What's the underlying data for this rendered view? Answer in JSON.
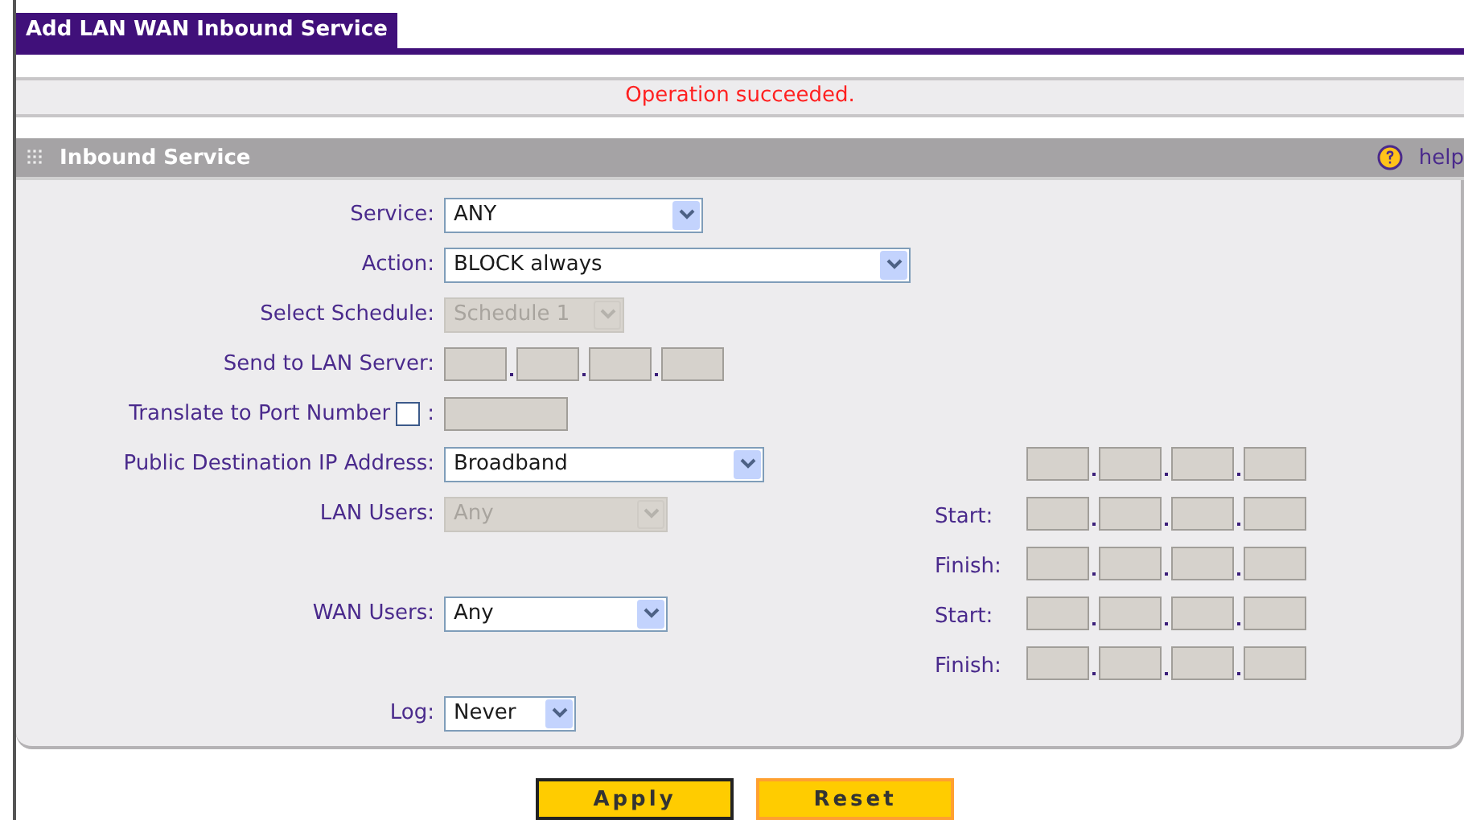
{
  "tab": {
    "title": "Add LAN WAN Inbound Service"
  },
  "message": "Operation succeeded.",
  "section": {
    "title": "Inbound Service",
    "help": "help"
  },
  "rows": [
    {
      "field": {
        "kind": "select",
        "label": "Service:",
        "value": "ANY",
        "disabled": false
      }
    },
    {
      "field": {
        "kind": "select",
        "label": "Action:",
        "value": "BLOCK always",
        "disabled": false
      }
    },
    {
      "field": {
        "kind": "select",
        "label": "Select Schedule:",
        "value": "Schedule 1",
        "disabled": true
      }
    },
    {
      "field": {
        "kind": "ip",
        "label": "Send to LAN Server:"
      }
    },
    {
      "field": {
        "kind": "port",
        "label": "Translate to Port Number",
        "separator": ":",
        "checked": false
      }
    },
    {
      "field": {
        "kind": "select",
        "label": "Public Destination IP Address:",
        "value": "Broadband",
        "disabled": false
      },
      "address": {
        "kind": "ip"
      }
    },
    {
      "field": {
        "kind": "select",
        "label": "LAN Users:",
        "value": "Any",
        "disabled": true
      },
      "address": {
        "kind": "ip",
        "label": "Start:"
      }
    },
    {
      "address": {
        "kind": "ip",
        "label": "Finish:"
      }
    },
    {
      "field": {
        "kind": "select",
        "label": "WAN Users:",
        "value": "Any",
        "disabled": false
      },
      "address": {
        "kind": "ip",
        "label": "Start:"
      }
    },
    {
      "address": {
        "kind": "ip",
        "label": "Finish:"
      }
    },
    {
      "field": {
        "kind": "select",
        "label": "Log:",
        "value": "Never",
        "disabled": false
      }
    }
  ],
  "buttons": [
    {
      "label": "Apply"
    },
    {
      "label": "Reset"
    }
  ]
}
